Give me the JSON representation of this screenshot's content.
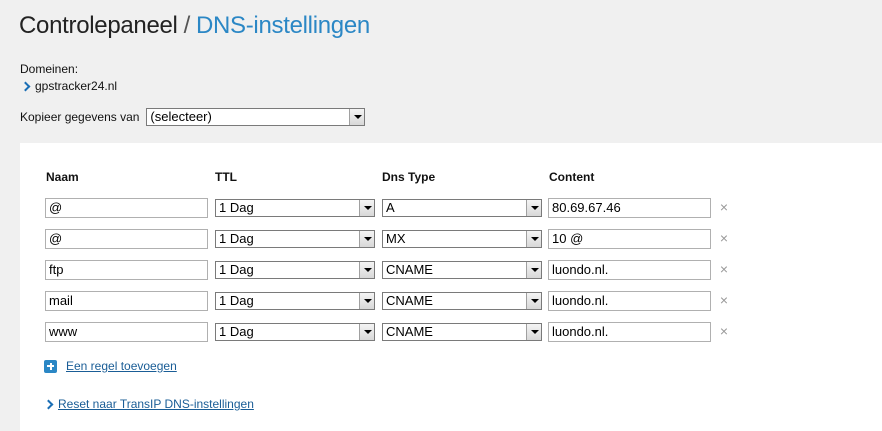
{
  "header": {
    "crumb_root": "Controlepaneel",
    "separator": "/",
    "crumb_current": "DNS-instellingen"
  },
  "domains": {
    "label": "Domeinen:",
    "items": [
      "gpstracker24.nl"
    ]
  },
  "copy": {
    "label": "Kopieer gegevens van",
    "selected": "(selecteer)"
  },
  "table": {
    "columns": {
      "name": "Naam",
      "ttl": "TTL",
      "type": "Dns Type",
      "content": "Content"
    },
    "rows": [
      {
        "name": "@",
        "ttl": "1 Dag",
        "type": "A",
        "content": "80.69.67.46"
      },
      {
        "name": "@",
        "ttl": "1 Dag",
        "type": "MX",
        "content": "10 @"
      },
      {
        "name": "ftp",
        "ttl": "1 Dag",
        "type": "CNAME",
        "content": "luondo.nl."
      },
      {
        "name": "mail",
        "ttl": "1 Dag",
        "type": "CNAME",
        "content": "luondo.nl."
      },
      {
        "name": "www",
        "ttl": "1 Dag",
        "type": "CNAME",
        "content": "luondo.nl."
      }
    ],
    "remove_glyph": "×"
  },
  "actions": {
    "add_rule": "Een regel toevoegen",
    "reset": "Reset naar TransIP DNS-instellingen"
  },
  "colors": {
    "accent": "#2b87c5",
    "link": "#1a5d96",
    "background": "#f0f0f0",
    "panel": "#ffffff"
  }
}
